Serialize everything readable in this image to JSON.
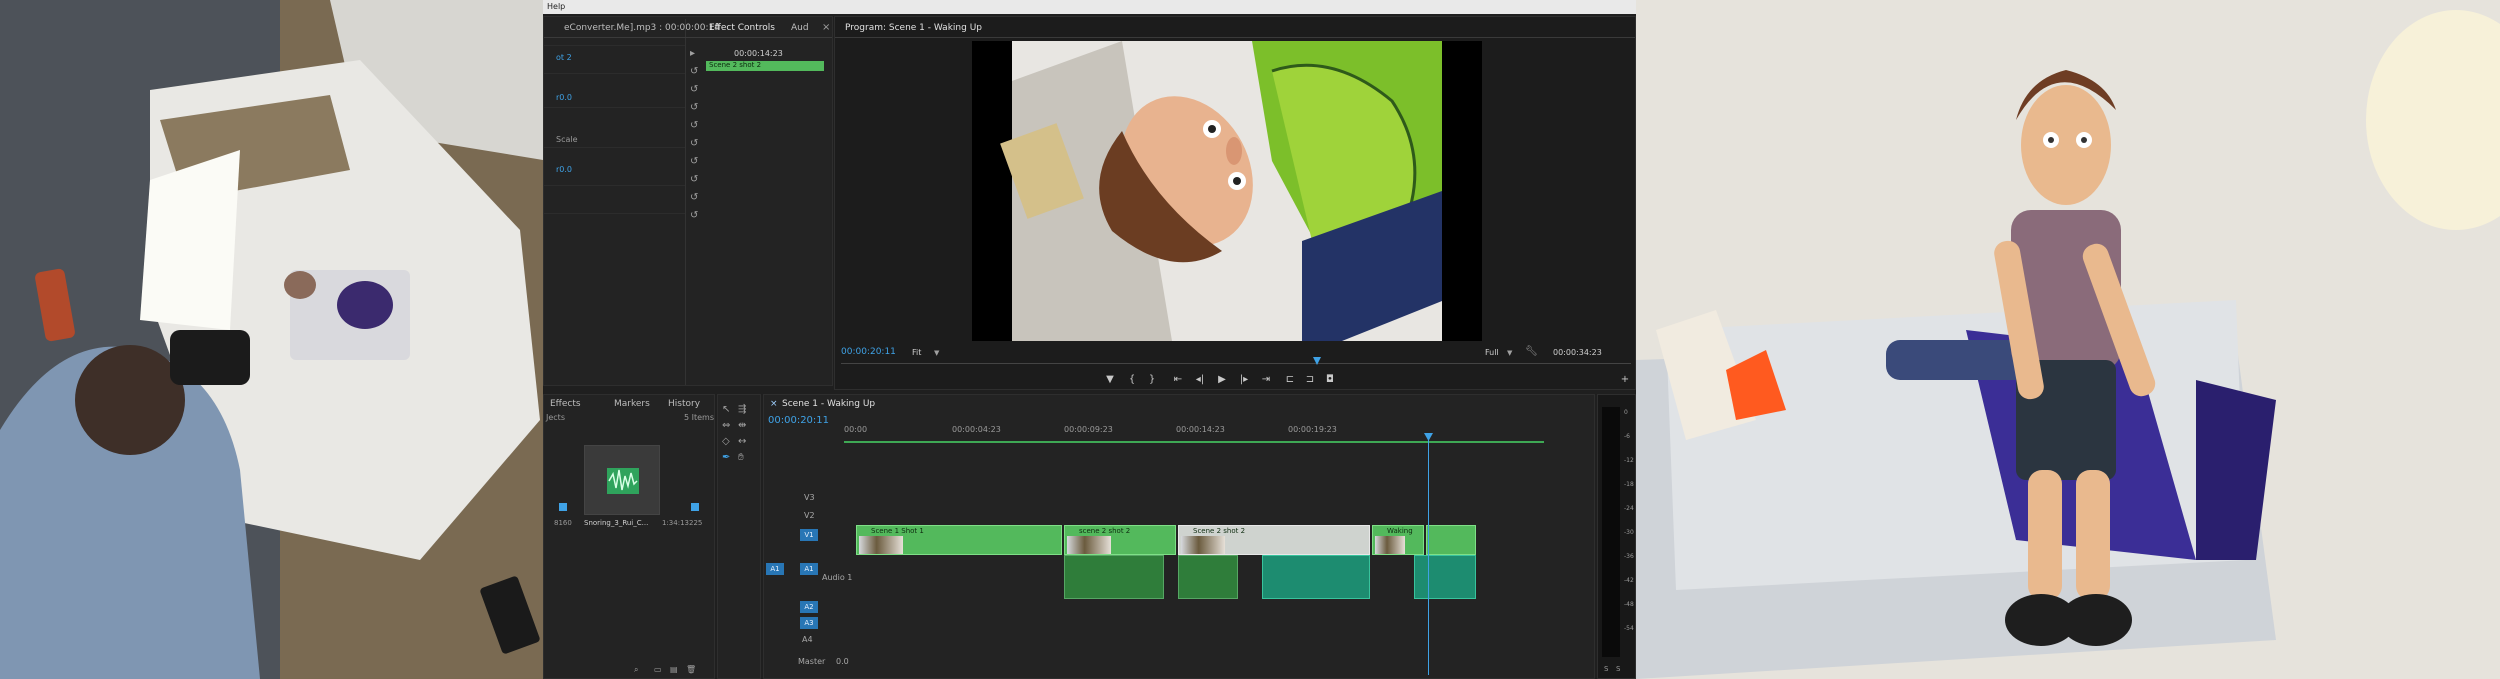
{
  "menu": {
    "label": "Help"
  },
  "source_panel": {
    "clip_title": "eConverter.Me].mp3 : 00:00:00:14",
    "rows": [
      "ot 2",
      "r0.0",
      "Scale",
      "r0.0"
    ]
  },
  "effect_controls": {
    "tabs": [
      "Effect Controls",
      "Aud"
    ],
    "timecode": "00:00:14:23",
    "clip_label": "Scene 2 shot 2"
  },
  "program_monitor": {
    "title": "Program: Scene 1 - Waking Up",
    "current_time": "00:00:20:11",
    "fit": "Fit",
    "resolution": "Full",
    "duration": "00:00:34:23"
  },
  "project_panel": {
    "tabs": [
      "Effects",
      "Markers",
      "History"
    ],
    "section": "Jects",
    "item_count": "5 Items",
    "item": {
      "rate": "8160",
      "name": "Snoring_3_Rui_C...",
      "duration": "1:34:13225"
    }
  },
  "timeline": {
    "title": "Scene 1 - Waking Up",
    "current_time": "00:00:20:11",
    "ruler": [
      "00:00",
      "00:00:04:23",
      "00:00:09:23",
      "00:00:14:23",
      "00:00:19:23"
    ],
    "video_tracks": [
      "V3",
      "V2",
      "V1"
    ],
    "audio_tracks": [
      "A1",
      "A2",
      "A3",
      "A4"
    ],
    "audio1_name": "Audio 1",
    "master": {
      "label": "Master",
      "value": "0.0"
    },
    "source_patch": {
      "video": "V1",
      "audio": "A1"
    },
    "clips": [
      {
        "label": "Scene 1 Shot 1"
      },
      {
        "label": "scene 2 shot 2"
      },
      {
        "label": "Scene 2 shot 2"
      },
      {
        "label": "Waking"
      }
    ]
  },
  "meter": {
    "scale": [
      "0",
      "-6",
      "-12",
      "-18",
      "-24",
      "-30",
      "-36",
      "-42",
      "-48",
      "-54"
    ],
    "footer": [
      "S",
      "S"
    ]
  },
  "colors": {
    "accent": "#3fa2e6",
    "clip_green": "#53b95c",
    "audio_teal": "#1d8c70",
    "panel_bg": "#232323"
  },
  "icons": [
    "wrench-icon",
    "play-icon",
    "step-back-icon",
    "step-forward-icon",
    "camera-icon",
    "marker-icon",
    "search-icon",
    "trash-icon"
  ]
}
